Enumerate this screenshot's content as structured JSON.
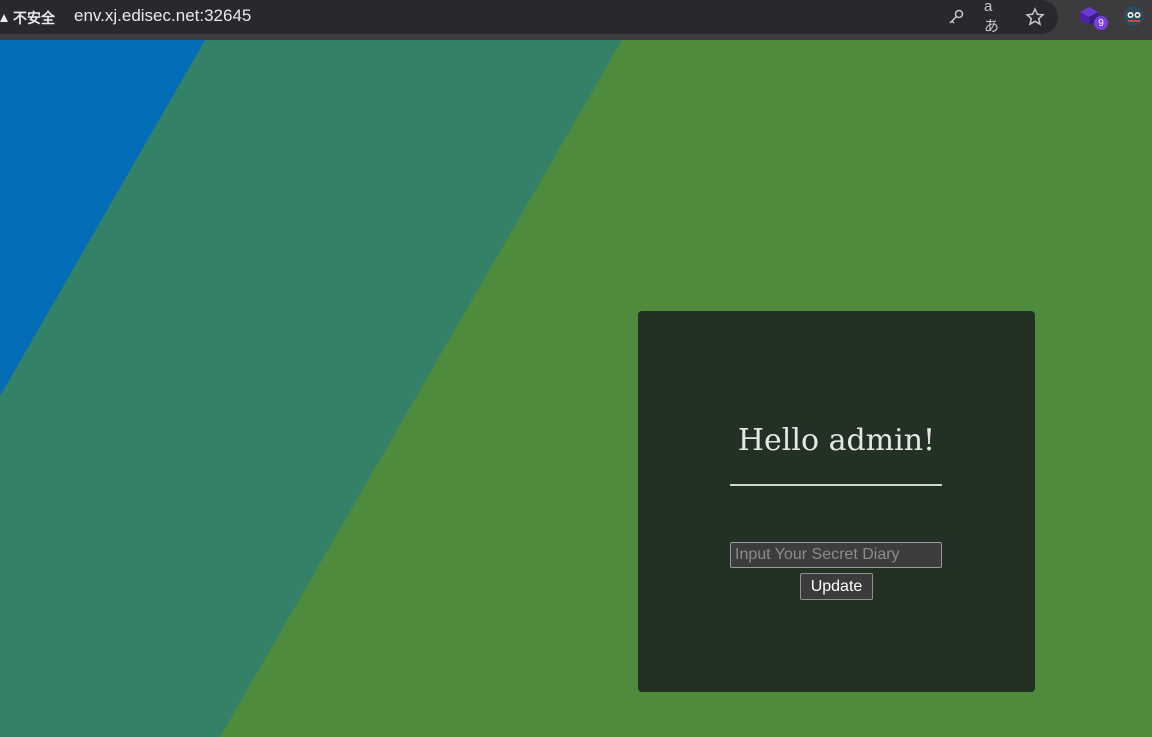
{
  "browser": {
    "security_label": "不安全",
    "url": "env.xj.edisec.net:32645",
    "extension_badge_count": "9",
    "icons": [
      "key-icon",
      "translate-icon",
      "star-icon",
      "extension-icon",
      "profile-icon"
    ]
  },
  "background": {
    "colors": {
      "blue": "#036db8",
      "teal": "#338267",
      "green": "#4f8b3c"
    }
  },
  "card": {
    "title": "Hello admin!",
    "input": {
      "value": "",
      "placeholder": "Input Your Secret Diary"
    },
    "button_label": "Update",
    "background_color": "#233125"
  }
}
